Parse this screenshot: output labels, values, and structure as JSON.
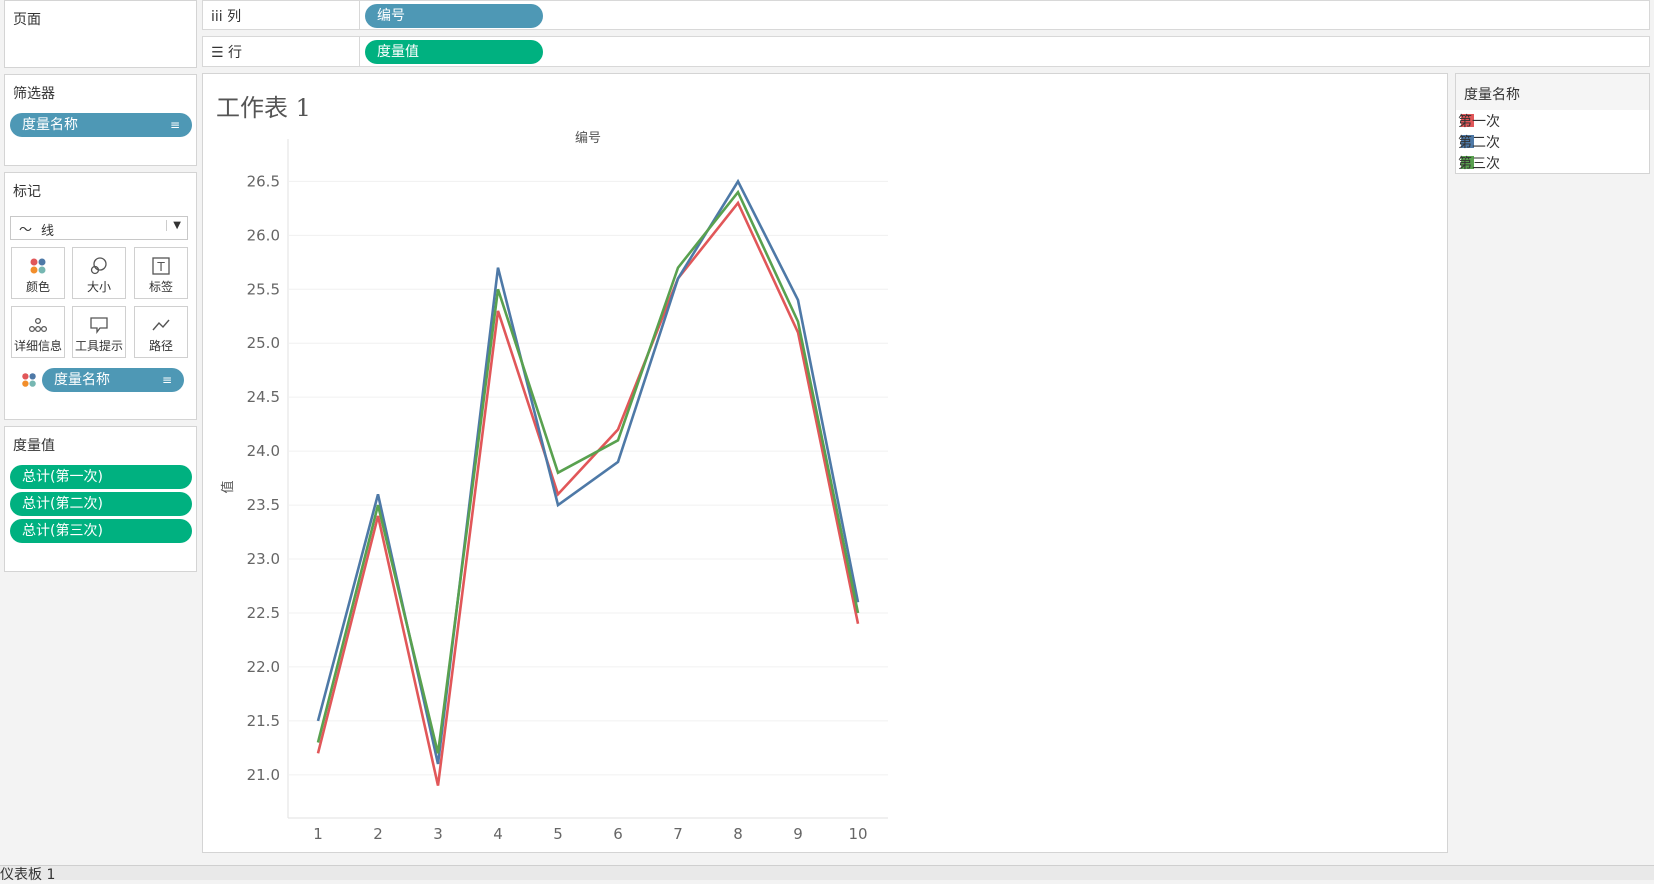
{
  "shelves": {
    "pages_label": "页面",
    "columns_label": "列",
    "columns_pill": "编号",
    "rows_label": "行",
    "rows_pill": "度量值"
  },
  "filters": {
    "title": "筛选器",
    "pill": "度量名称"
  },
  "marks": {
    "title": "标记",
    "mark_type": "线",
    "buttons": [
      "颜色",
      "大小",
      "标签",
      "详细信息",
      "工具提示",
      "路径"
    ],
    "color_pill": "度量名称"
  },
  "measure_values": {
    "title": "度量值",
    "items": [
      "总计(第一次)",
      "总计(第二次)",
      "总计(第三次)"
    ]
  },
  "worksheet": {
    "title": "工作表 1"
  },
  "legend": {
    "title": "度量名称",
    "items": [
      {
        "label": "第一次",
        "color": "#e15759"
      },
      {
        "label": "第二次",
        "color": "#4e79a7"
      },
      {
        "label": "第三次",
        "color": "#59a14f"
      }
    ]
  },
  "bottom_tab": "仪表板 1",
  "chart_data": {
    "type": "line",
    "title": "编号",
    "xlabel": "",
    "ylabel": "值",
    "categories": [
      "1",
      "2",
      "3",
      "4",
      "5",
      "6",
      "7",
      "8",
      "9",
      "10"
    ],
    "ylim": [
      20.6,
      26.8
    ],
    "yticks": [
      "21.0",
      "21.5",
      "22.0",
      "22.5",
      "23.0",
      "23.5",
      "24.0",
      "24.5",
      "25.0",
      "25.5",
      "26.0",
      "26.5"
    ],
    "series": [
      {
        "name": "第一次",
        "color": "#e15759",
        "values": [
          21.2,
          23.4,
          20.9,
          25.3,
          23.6,
          24.2,
          25.6,
          26.3,
          25.1,
          22.4
        ]
      },
      {
        "name": "第二次",
        "color": "#4e79a7",
        "values": [
          21.5,
          23.6,
          21.1,
          25.7,
          23.5,
          23.9,
          25.6,
          26.5,
          25.4,
          22.6
        ]
      },
      {
        "name": "第三次",
        "color": "#59a14f",
        "values": [
          21.3,
          23.5,
          21.2,
          25.5,
          23.8,
          24.1,
          25.7,
          26.4,
          25.2,
          22.5
        ]
      }
    ]
  }
}
